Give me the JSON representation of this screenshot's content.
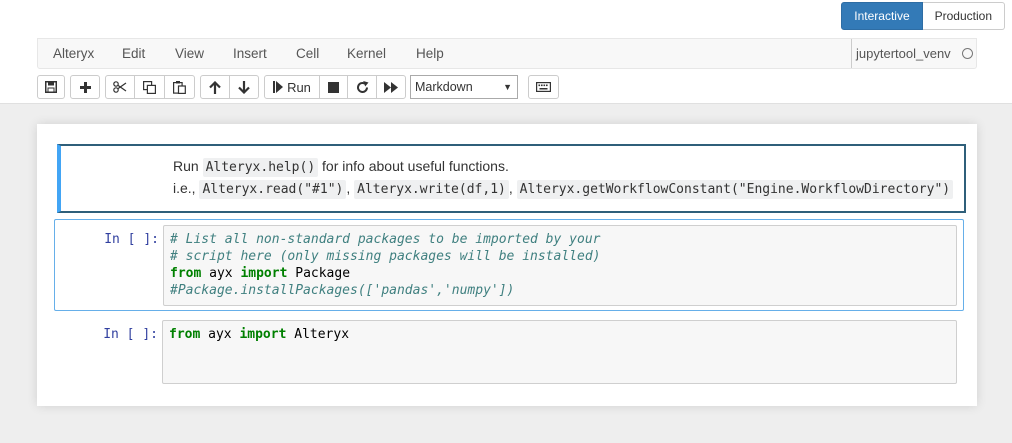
{
  "mode_toggle": {
    "interactive": "Interactive",
    "production": "Production"
  },
  "menu": [
    "Alteryx",
    "Edit",
    "View",
    "Insert",
    "Cell",
    "Kernel",
    "Help"
  ],
  "kernel": {
    "name": "jupytertool_venv"
  },
  "toolbar": {
    "run_label": "Run",
    "cell_type": "Markdown",
    "icons": [
      "save-icon",
      "plus-icon",
      "cut-icon",
      "copy-icon",
      "paste-icon",
      "arrow-up-icon",
      "arrow-down-icon",
      "run-icon",
      "stop-icon",
      "restart-icon",
      "fast-forward-icon",
      "keyboard-icon"
    ]
  },
  "markdown_cell": {
    "line1_prefix": "Run",
    "line1_code": "Alteryx.help()",
    "line1_suffix": "for info about useful functions.",
    "line2_prefix": "i.e.,",
    "code_read": "Alteryx.read(\"#1\")",
    "code_write": "Alteryx.write(df,1)",
    "code_const": "Alteryx.getWorkflowConstant(\"Engine.WorkflowDirectory\")",
    "sep": ","
  },
  "code_cells": [
    {
      "prompt": "In [ ]:",
      "line1": "# List all non-standard packages to be imported by your",
      "line2": "# script here (only missing packages will be installed)",
      "line3_kw1": "from",
      "line3_mod": " ayx ",
      "line3_kw2": "import",
      "line3_name": " Package",
      "line4": "#Package.installPackages(['pandas','numpy'])"
    },
    {
      "prompt": "In [ ]:",
      "line1_kw1": "from",
      "line1_mod": " ayx ",
      "line1_kw2": "import",
      "line1_name": " Alteryx"
    }
  ]
}
